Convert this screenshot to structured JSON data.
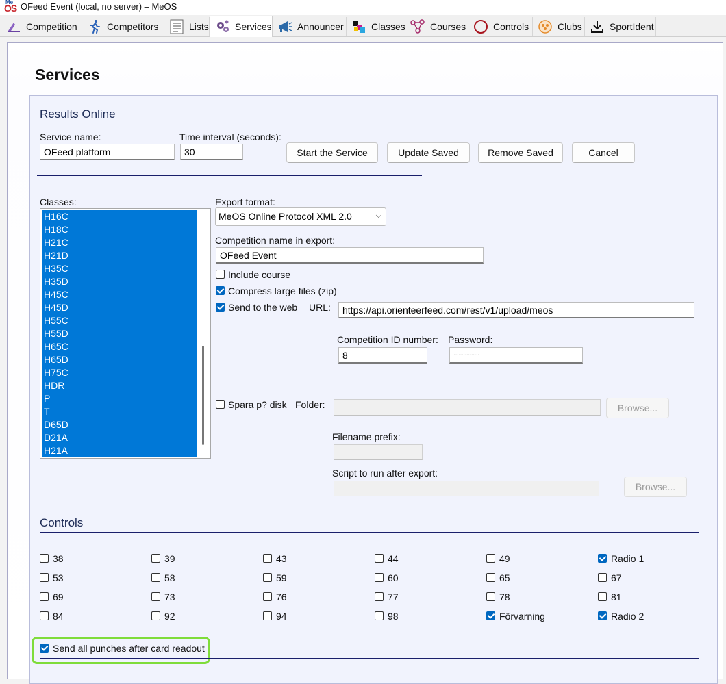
{
  "window": {
    "title": "OFeed Event (local, no server) – MeOS",
    "logo_top": "Me",
    "logo_bottom": "OS"
  },
  "tabs": [
    {
      "label": "Competition",
      "icon": "competition-icon"
    },
    {
      "label": "Competitors",
      "icon": "runner-icon"
    },
    {
      "label": "Lists",
      "icon": "list-icon"
    },
    {
      "label": "Services",
      "icon": "services-gears-icon",
      "active": true
    },
    {
      "label": "Announcer",
      "icon": "megaphone-icon"
    },
    {
      "label": "Classes",
      "icon": "classes-icon"
    },
    {
      "label": "Courses",
      "icon": "courses-icon"
    },
    {
      "label": "Controls",
      "icon": "control-circle-icon"
    },
    {
      "label": "Clubs",
      "icon": "club-icon"
    },
    {
      "label": "SportIdent",
      "icon": "download-icon"
    }
  ],
  "page": {
    "title": "Services"
  },
  "results_online": {
    "title": "Results Online",
    "service_name_label": "Service name:",
    "service_name_value": "OFeed platform",
    "time_interval_label": "Time interval (seconds):",
    "time_interval_value": "30",
    "buttons": {
      "start": "Start the Service",
      "update": "Update Saved",
      "remove": "Remove Saved",
      "cancel": "Cancel"
    }
  },
  "classes": {
    "label": "Classes:",
    "items": [
      "H16C",
      "H18C",
      "H21C",
      "H21D",
      "H35C",
      "H35D",
      "H45C",
      "H45D",
      "H55C",
      "H55D",
      "H65C",
      "H65D",
      "H75C",
      "HDR",
      "P",
      "T",
      "D65D",
      "D21A",
      "H21A"
    ]
  },
  "export": {
    "format_label": "Export format:",
    "format_value": "MeOS Online Protocol XML 2.0",
    "competition_name_label": "Competition name in export:",
    "competition_name_value": "OFeed Event",
    "include_course_label": "Include course",
    "include_course_checked": false,
    "compress_label": "Compress large files (zip)",
    "compress_checked": true,
    "send_web_label": "Send to the web",
    "send_web_checked": true,
    "url_label": "URL:",
    "url_value": "https://api.orienteerfeed.com/rest/v1/upload/meos",
    "competition_id_label": "Competition ID number:",
    "competition_id_value": "8",
    "password_label": "Password:",
    "password_value": "················",
    "save_disk_label": "Spara p? disk",
    "save_disk_checked": false,
    "folder_label": "Folder:",
    "folder_value": "",
    "browse_label": "Browse...",
    "filename_prefix_label": "Filename prefix:",
    "filename_prefix_value": "",
    "script_label": "Script to run after export:",
    "script_value": "",
    "browse2_label": "Browse..."
  },
  "controls": {
    "title": "Controls",
    "rows": [
      [
        {
          "label": "38",
          "checked": false
        },
        {
          "label": "39",
          "checked": false
        },
        {
          "label": "43",
          "checked": false
        },
        {
          "label": "44",
          "checked": false
        },
        {
          "label": "49",
          "checked": false
        },
        {
          "label": "Radio 1",
          "checked": true
        }
      ],
      [
        {
          "label": "53",
          "checked": false
        },
        {
          "label": "58",
          "checked": false
        },
        {
          "label": "59",
          "checked": false
        },
        {
          "label": "60",
          "checked": false
        },
        {
          "label": "65",
          "checked": false
        },
        {
          "label": "67",
          "checked": false
        }
      ],
      [
        {
          "label": "69",
          "checked": false
        },
        {
          "label": "73",
          "checked": false
        },
        {
          "label": "76",
          "checked": false
        },
        {
          "label": "77",
          "checked": false
        },
        {
          "label": "78",
          "checked": false
        },
        {
          "label": "81",
          "checked": false
        }
      ],
      [
        {
          "label": "84",
          "checked": false
        },
        {
          "label": "92",
          "checked": false
        },
        {
          "label": "94",
          "checked": false
        },
        {
          "label": "98",
          "checked": false
        },
        {
          "label": "Förvarning",
          "checked": true
        },
        {
          "label": "Radio 2",
          "checked": true
        }
      ]
    ],
    "send_all_label": "Send all punches after card readout",
    "send_all_checked": true
  },
  "colors": {
    "accent": "#0078d7",
    "highlight": "#7fdc3a",
    "rule": "#1a1f6b",
    "section_bg": "#f1f3fd"
  }
}
